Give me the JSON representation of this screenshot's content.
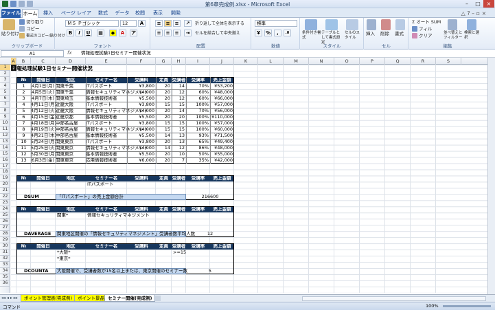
{
  "window": {
    "title": "第6章完成例.xlsx - Microsoft Excel"
  },
  "tabs": [
    "ファイル",
    "ホーム",
    "挿入",
    "ページ レイアウト",
    "数式",
    "データ",
    "校閲",
    "表示",
    "開発"
  ],
  "ribbon": {
    "clipboard": {
      "paste": "貼り付け",
      "cut": "切り取り",
      "copy": "コピー",
      "format_painter": "書式のコピー/貼り付け",
      "label": "クリップボード"
    },
    "font": {
      "name": "ＭＳ Ｐゴシック",
      "size": "12",
      "bold": "B",
      "italic": "I",
      "underline": "U",
      "label": "フォント"
    },
    "alignment": {
      "wrap": "折り返して全体を表示する",
      "merge": "セルを結合して中央揃え",
      "label": "配置"
    },
    "number": {
      "format": "標準",
      "label": "数値"
    },
    "styles": {
      "conditional": "条件付き書式",
      "table": "テーブルとして書式設定",
      "cell": "セルのスタイル",
      "label": "スタイル"
    },
    "cells": {
      "insert": "挿入",
      "delete": "削除",
      "format": "書式",
      "label": "セル"
    },
    "editing": {
      "autosum": "オート SUM",
      "fill": "フィル",
      "clear": "クリア",
      "sort": "並べ替えとフィルター",
      "find": "検索と選択",
      "label": "編集"
    }
  },
  "formula_bar": {
    "name_box": "A1",
    "fx": "fx",
    "content": "情報処理試験1日セミナー開催状況"
  },
  "columns": [
    "A",
    "B",
    "C",
    "D",
    "E",
    "F",
    "G",
    "H",
    "I",
    "J",
    "K",
    "L",
    "M",
    "N",
    "O",
    "P",
    "Q",
    "R",
    "S"
  ],
  "rows": [
    "1",
    "2",
    "3",
    "4",
    "5",
    "6",
    "7",
    "8",
    "9",
    "10",
    "11",
    "12",
    "13",
    "14",
    "15",
    "16",
    "17",
    "18",
    "19",
    "20",
    "21",
    "22",
    "23",
    "24",
    "25",
    "26",
    "27",
    "28",
    "29",
    "30",
    "31",
    "32",
    "33",
    "34",
    "35",
    "36"
  ],
  "sheet_title": "情報処理試験1日セミナー開催状況",
  "main_headers": [
    "№",
    "開催日",
    "地区",
    "セミナー名",
    "受講料",
    "定員",
    "受講者数",
    "受講率",
    "売上金額"
  ],
  "main_rows": [
    [
      "1",
      "4月1日(月)",
      "関東千葉",
      "ITパスポート",
      "¥3,800",
      "20",
      "14",
      "70%",
      "¥53,200"
    ],
    [
      "2",
      "4月5日(火)",
      "関東千葉",
      "情報セキュリティマネジメント",
      "¥4,000",
      "20",
      "12",
      "60%",
      "¥48,000"
    ],
    [
      "3",
      "4月7日(木)",
      "関東埼玉",
      "基本情報技術者",
      "¥5,500",
      "20",
      "12",
      "60%",
      "¥66,000"
    ],
    [
      "4",
      "4月11日(月)",
      "近畿大阪",
      "ITパスポート",
      "¥3,800",
      "15",
      "15",
      "100%",
      "¥57,000"
    ],
    [
      "5",
      "4月12日(火)",
      "近畿大阪",
      "情報セキュリティマネジメント",
      "¥4,000",
      "20",
      "14",
      "70%",
      "¥56,000"
    ],
    [
      "6",
      "4月15日(金)",
      "近畿京都",
      "基本情報技術者",
      "¥5,500",
      "20",
      "20",
      "100%",
      "¥110,000"
    ],
    [
      "7",
      "4月18日(月)",
      "中部名古屋",
      "ITパスポート",
      "¥3,800",
      "15",
      "15",
      "100%",
      "¥57,000"
    ],
    [
      "8",
      "4月19日(火)",
      "中部名古屋",
      "情報セキュリティマネジメント",
      "¥4,000",
      "15",
      "15",
      "100%",
      "¥60,000"
    ],
    [
      "9",
      "4月21日(木)",
      "中部名古屋",
      "基本情報技術者",
      "¥5,500",
      "14",
      "13",
      "93%",
      "¥71,500"
    ],
    [
      "10",
      "5月24日(月)",
      "関東東京",
      "ITパスポート",
      "¥3,800",
      "20",
      "13",
      "65%",
      "¥49,400"
    ],
    [
      "11",
      "5月25日(火)",
      "関東東京",
      "情報セキュリティマネジメント",
      "¥4,000",
      "14",
      "12",
      "86%",
      "¥48,000"
    ],
    [
      "12",
      "5月30日(月)",
      "関東東京",
      "基本情報技術者",
      "¥5,500",
      "20",
      "10",
      "50%",
      "¥55,000"
    ],
    [
      "13",
      "6月3日(金)",
      "関東東京",
      "応用情報技術者",
      "¥6,000",
      "20",
      "7",
      "35%",
      "¥42,000"
    ]
  ],
  "criteria_headers": [
    "№",
    "開催日",
    "地区",
    "セミナー名",
    "受講料",
    "定員",
    "受講者数",
    "受講率",
    "売上金額"
  ],
  "dsum": {
    "criteria": "ITパスポート",
    "label": "DSUM",
    "desc": "「ITパスポート」の売上金額合計",
    "value": "216600"
  },
  "daverage": {
    "criteria_region": "関東*",
    "criteria_seminar": "情報セキュリティマネジメント",
    "label": "DAVERAGE",
    "desc": "関東地区開催の「情報セキュリティマネジメント」受講者数平均人数",
    "value": "12"
  },
  "dcounta": {
    "crit1": "*大阪*",
    "crit_count": ">=15",
    "crit2": "*東京*",
    "label": "DCOUNTA",
    "desc": "大阪開催で、受講者数が15名以上または、東京開催のセミナー数",
    "value": "5"
  },
  "sheet_tabs": [
    "ポイント管理表(完成例)",
    "ポイント景品",
    "セミナー開催(完成例)"
  ],
  "status": {
    "left": "コマンド",
    "zoom": "100%"
  }
}
